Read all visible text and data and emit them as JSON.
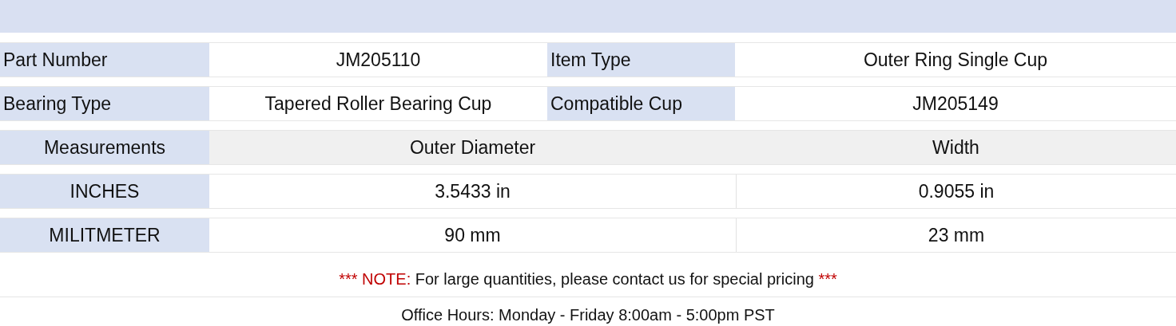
{
  "specs": [
    {
      "label": "Part Number",
      "value": "JM205110",
      "label2": "Item Type",
      "value2": "Outer Ring Single Cup"
    },
    {
      "label": "Bearing Type",
      "value": "Tapered Roller Bearing Cup",
      "label2": "Compatible Cup",
      "value2": "JM205149"
    }
  ],
  "measurements": {
    "header": {
      "label": "Measurements",
      "col1": "Outer Diameter",
      "col2": "Width"
    },
    "rows": [
      {
        "label": "INCHES",
        "col1": "3.5433 in",
        "col2": "0.9055 in"
      },
      {
        "label": "MILITMETER",
        "col1": "90 mm",
        "col2": "23 mm"
      }
    ]
  },
  "note": {
    "prefix": "*** NOTE:",
    "text": "For large quantities, please contact us for special pricing",
    "suffix": "***"
  },
  "office_hours": "Office Hours: Monday - Friday 8:00am - 5:00pm PST"
}
